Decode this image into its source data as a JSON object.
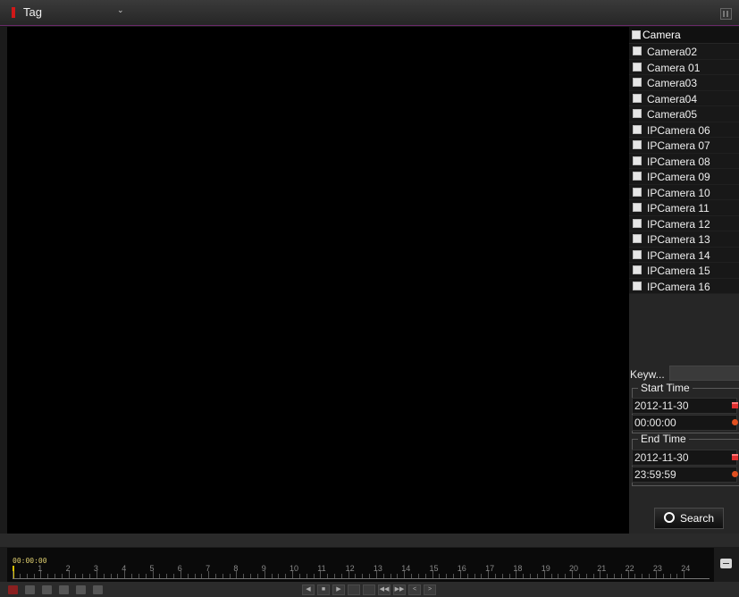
{
  "header": {
    "title": "Tag"
  },
  "camera_panel": {
    "header_label": "Camera",
    "cameras": [
      "Camera02",
      "Camera 01",
      "Camera03",
      "Camera04",
      "Camera05",
      "IPCamera 06",
      "IPCamera 07",
      "IPCamera 08",
      "IPCamera 09",
      "IPCamera 10",
      "IPCamera 11",
      "IPCamera 12",
      "IPCamera 13",
      "IPCamera 14",
      "IPCamera 15",
      "IPCamera 16"
    ]
  },
  "filters": {
    "keyword_label": "Keyw...",
    "start_time_label": "Start Time",
    "start_date": "2012-11-30",
    "start_time": "00:00:00",
    "end_time_label": "End Time",
    "end_date": "2012-11-30",
    "end_time": "23:59:59",
    "search_label": "Search"
  },
  "timeline": {
    "current": "00:00:00",
    "hours": [
      "1",
      "2",
      "3",
      "4",
      "5",
      "6",
      "7",
      "8",
      "9",
      "10",
      "11",
      "12",
      "13",
      "14",
      "15",
      "16",
      "17",
      "18",
      "19",
      "20",
      "21",
      "22",
      "23",
      "24"
    ]
  }
}
